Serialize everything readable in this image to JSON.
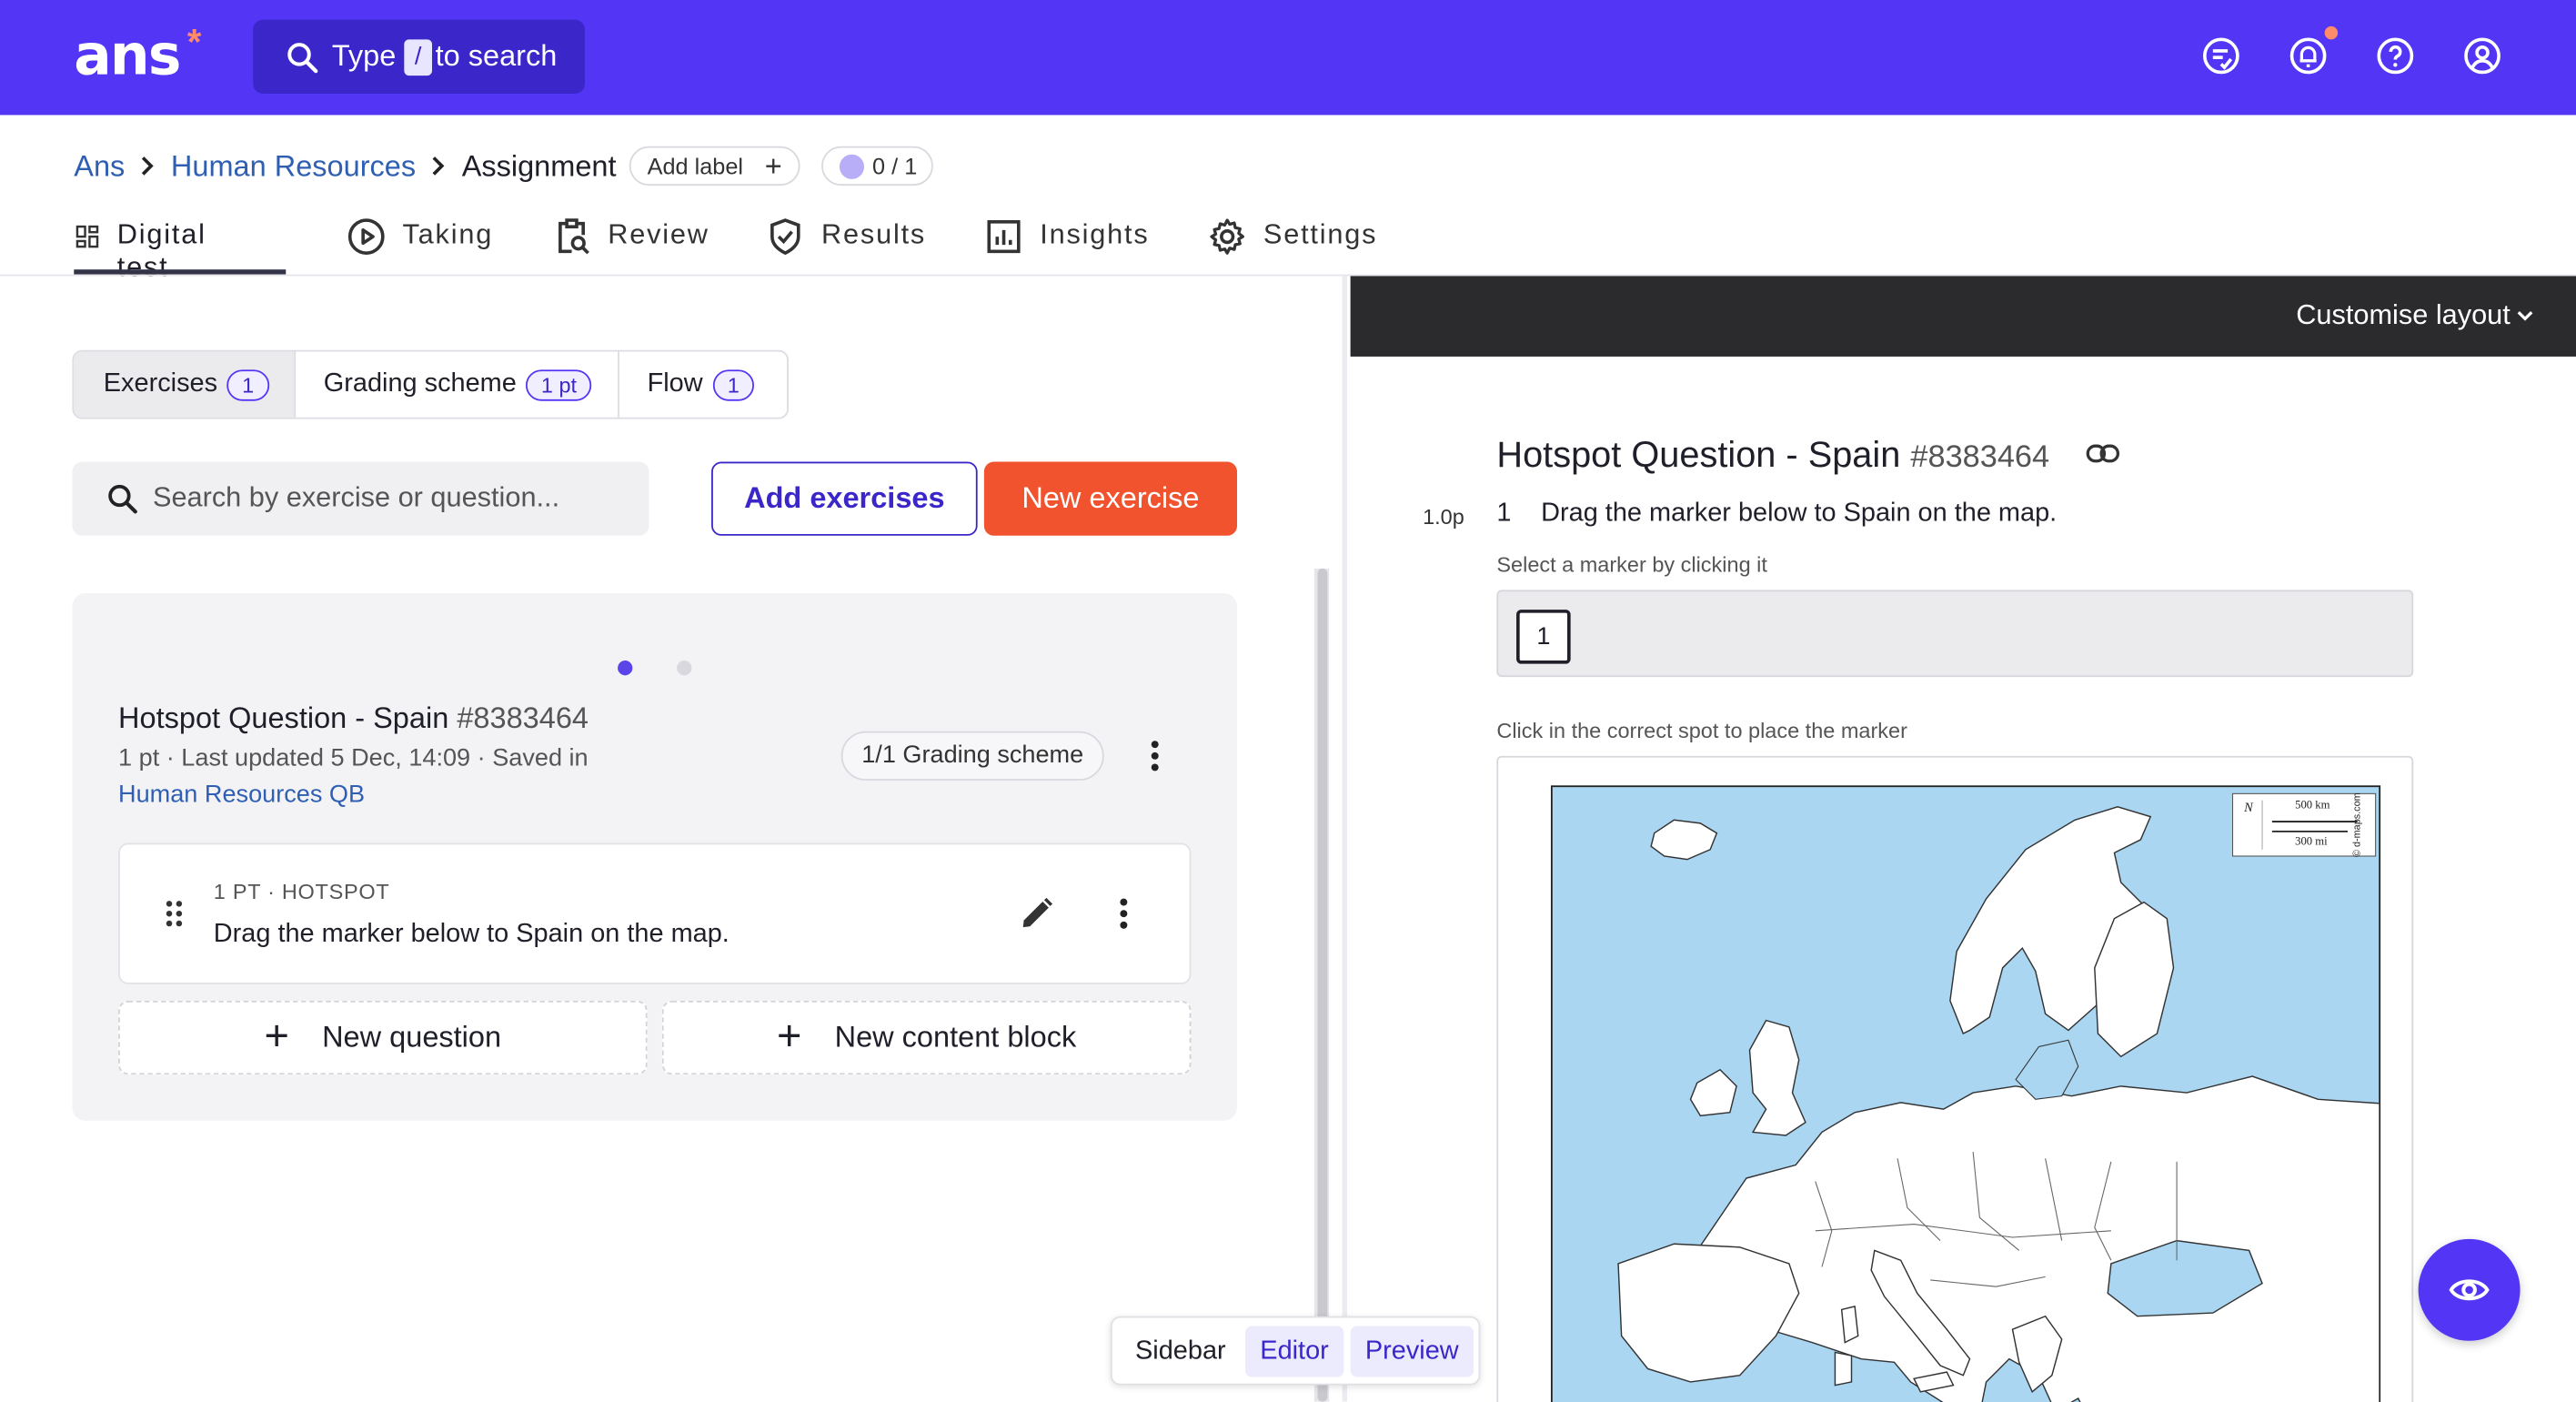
{
  "topbar": {
    "logo": "ans",
    "logo_mark": "*",
    "search": {
      "prefix": "Type",
      "key": "/",
      "suffix": "to search"
    },
    "icons": [
      "tasks-icon",
      "notification-bell-icon",
      "help-icon",
      "account-icon"
    ],
    "brand_color": "#5336f5",
    "notification_dot_color": "#ff8b6b"
  },
  "breadcrumb": {
    "root": "Ans",
    "section": "Human Resources",
    "current": "Assignment",
    "add_label": "Add label",
    "progress": "0 / 1"
  },
  "tabs": [
    {
      "label": "Digital test",
      "icon": "dashboard-icon",
      "active": true
    },
    {
      "label": "Taking",
      "icon": "play-icon"
    },
    {
      "label": "Review",
      "icon": "clipboard-search-icon"
    },
    {
      "label": "Results",
      "icon": "shield-check-icon"
    },
    {
      "label": "Insights",
      "icon": "bar-chart-icon"
    },
    {
      "label": "Settings",
      "icon": "gear-icon"
    }
  ],
  "segments": [
    {
      "label": "Exercises",
      "badge": "1",
      "active": true
    },
    {
      "label": "Grading scheme",
      "badge": "1 pt"
    },
    {
      "label": "Flow",
      "badge": "1"
    }
  ],
  "exercise_search": {
    "placeholder": "Search by exercise or question..."
  },
  "buttons": {
    "add_exercises": "Add exercises",
    "new_exercise": "New exercise"
  },
  "exercise": {
    "title": "Hotspot Question - Spain",
    "id": "#8383464",
    "meta": "1 pt · Last updated 5 Dec, 14:09 · Saved in",
    "bank": "Human Resources QB",
    "grading": "1/1 Grading scheme",
    "question": {
      "meta": "1 PT · HOTSPOT",
      "text": "Drag the marker below to Spain on the map."
    },
    "new_question": "New question",
    "new_content_block": "New content block"
  },
  "view_switch": {
    "sidebar": "Sidebar",
    "editor": "Editor",
    "preview": "Preview"
  },
  "preview": {
    "customise": "Customise layout",
    "title": "Hotspot Question - Spain",
    "id": "#8383464",
    "points": "1.0p",
    "number": "1",
    "question": "Drag the marker below to Spain on the map.",
    "select_label": "Select a marker by clicking it",
    "marker": "1",
    "click_label": "Click in the correct spot to place the marker",
    "map_scale": {
      "km": "500 km",
      "mi": "300 mi",
      "north": "N",
      "credit": "© d-maps.com"
    }
  }
}
